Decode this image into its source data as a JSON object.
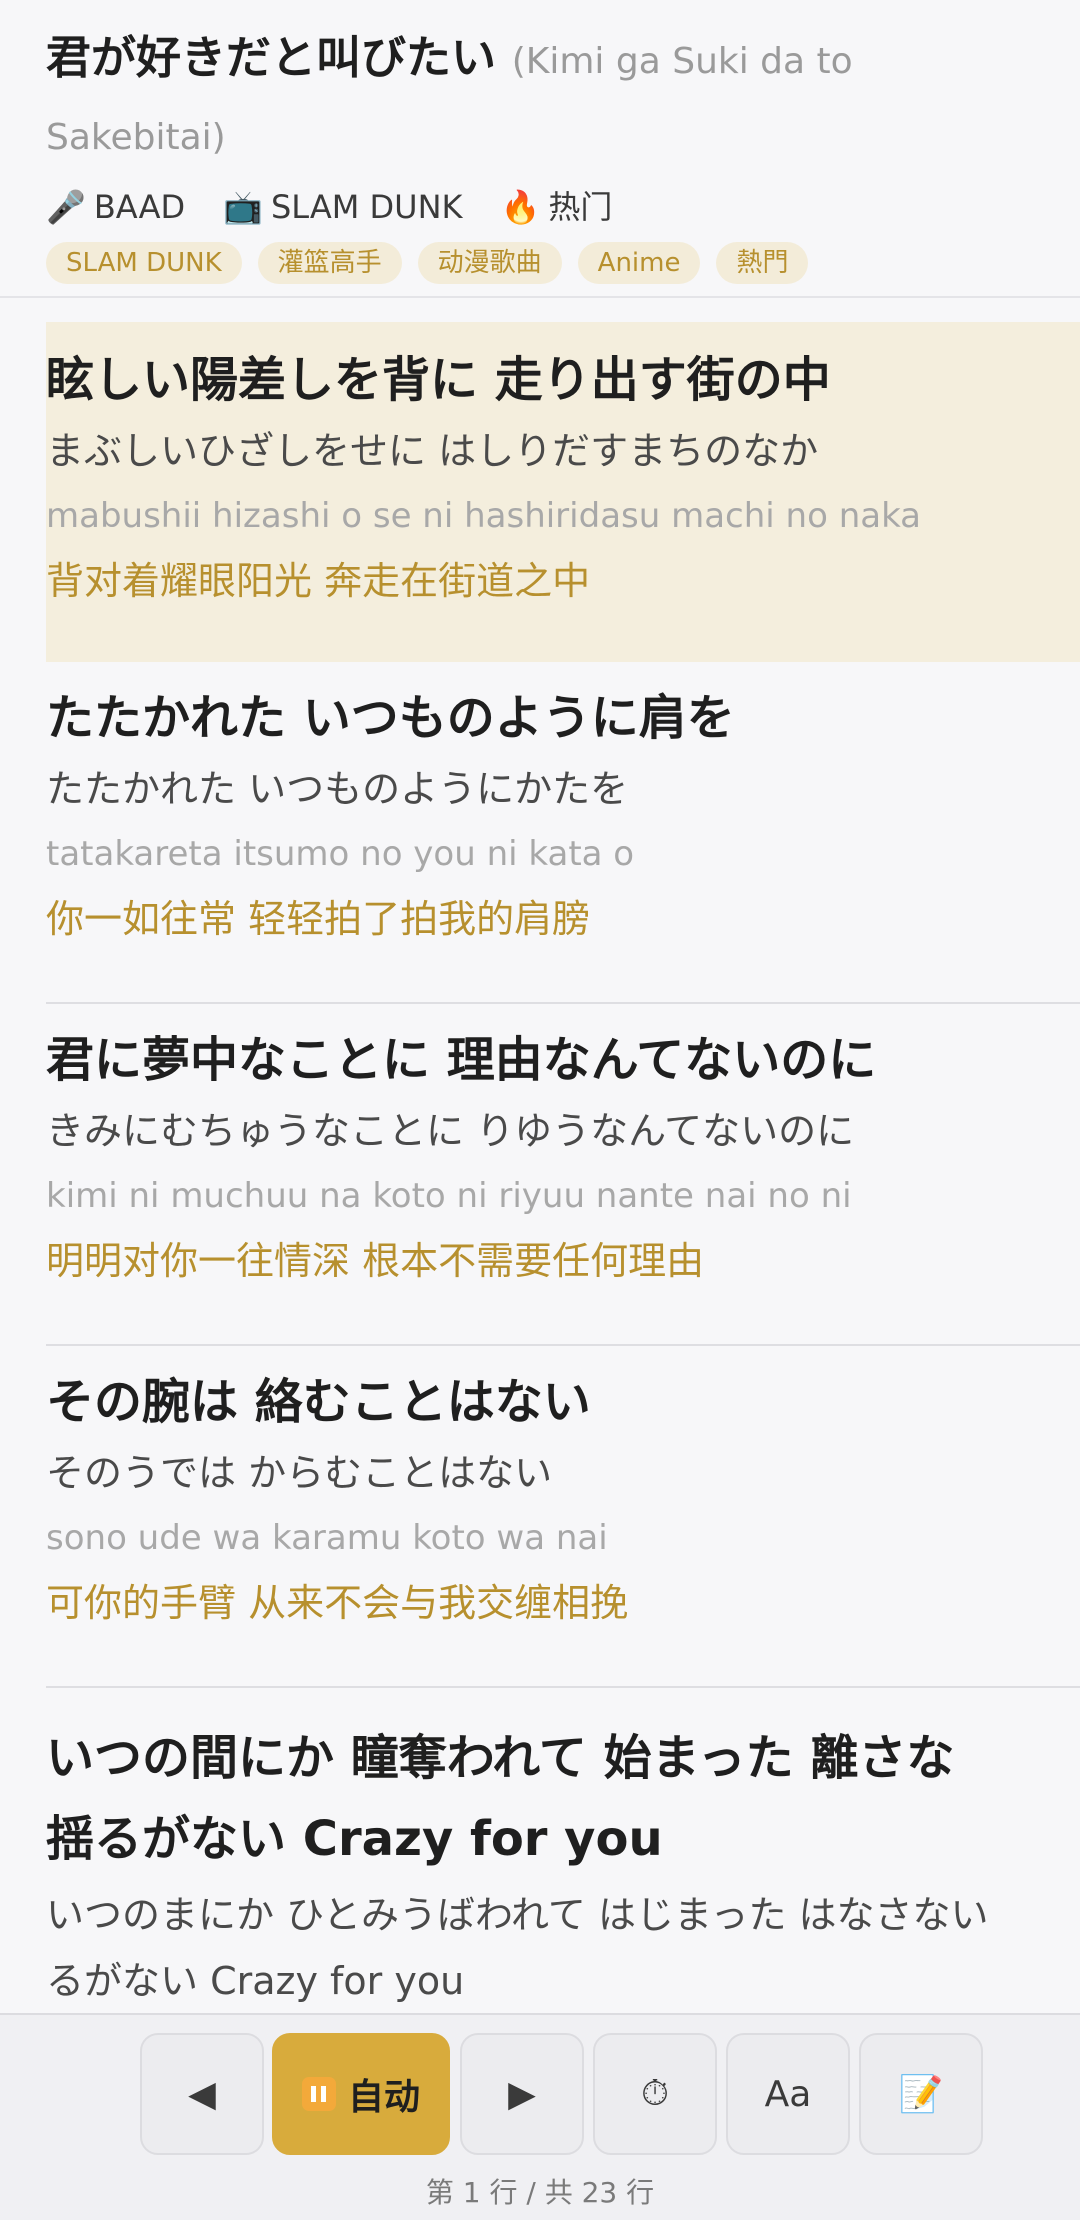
{
  "song": {
    "title": "君が好きだと叫びたい",
    "romaji_title": "(Kimi ga Suki da to Sakebitai)",
    "artist_icon": "🎤",
    "artist": "BAAD",
    "source_icon": "📺",
    "source": "SLAM DUNK",
    "hot_icon": "🔥",
    "hot_label": "热门",
    "tags": [
      "SLAM DUNK",
      "灌篮高手",
      "动漫歌曲",
      "Anime",
      "熱門"
    ]
  },
  "lyrics": [
    {
      "jp": "眩しい陽差しを背に 走り出す街の中",
      "kana": "まぶしいひざしをせに はしりだすまちのなか",
      "romaji": "mabushii hizashi o se ni hashiridasu machi no naka",
      "cn": "背对着耀眼阳光 奔走在街道之中"
    },
    {
      "jp": "たたかれた いつものように肩を",
      "kana": "たたかれた いつものようにかたを",
      "romaji": "tatakareta itsumo no you ni kata o",
      "cn": "你一如往常 轻轻拍了拍我的肩膀"
    },
    {
      "jp": "君に夢中なことに 理由なんてないのに",
      "kana": "きみにむちゅうなことに りゆうなんてないのに",
      "romaji": "kimi ni muchuu na koto ni riyuu nante nai no ni",
      "cn": "明明对你一往情深 根本不需要任何理由"
    },
    {
      "jp": "その腕は 絡むことはない",
      "kana": "そのうでは からむことはない",
      "romaji": "sono ude wa karamu koto wa nai",
      "cn": "可你的手臂 从来不会与我交缠相挽"
    },
    {
      "jp": "いつの間にか 瞳奪われて 始まった 離さな",
      "jp2": "揺るがない Crazy for you",
      "kana": "いつのまにか ひとみうばわれて はじまった はなさない",
      "kana2": "るがない Crazy for you"
    }
  ],
  "controls": {
    "prev_icon": "◀",
    "auto_label": "自动",
    "next_icon": "▶",
    "timer_icon": "⏱",
    "font_label": "Aa",
    "notes_icon": "📝",
    "page_info": "第 1 行 / 共 23 行"
  },
  "colors": {
    "accent": "#d8ab3c",
    "translation": "#b7902e",
    "active_bg": "#f4eedd"
  }
}
